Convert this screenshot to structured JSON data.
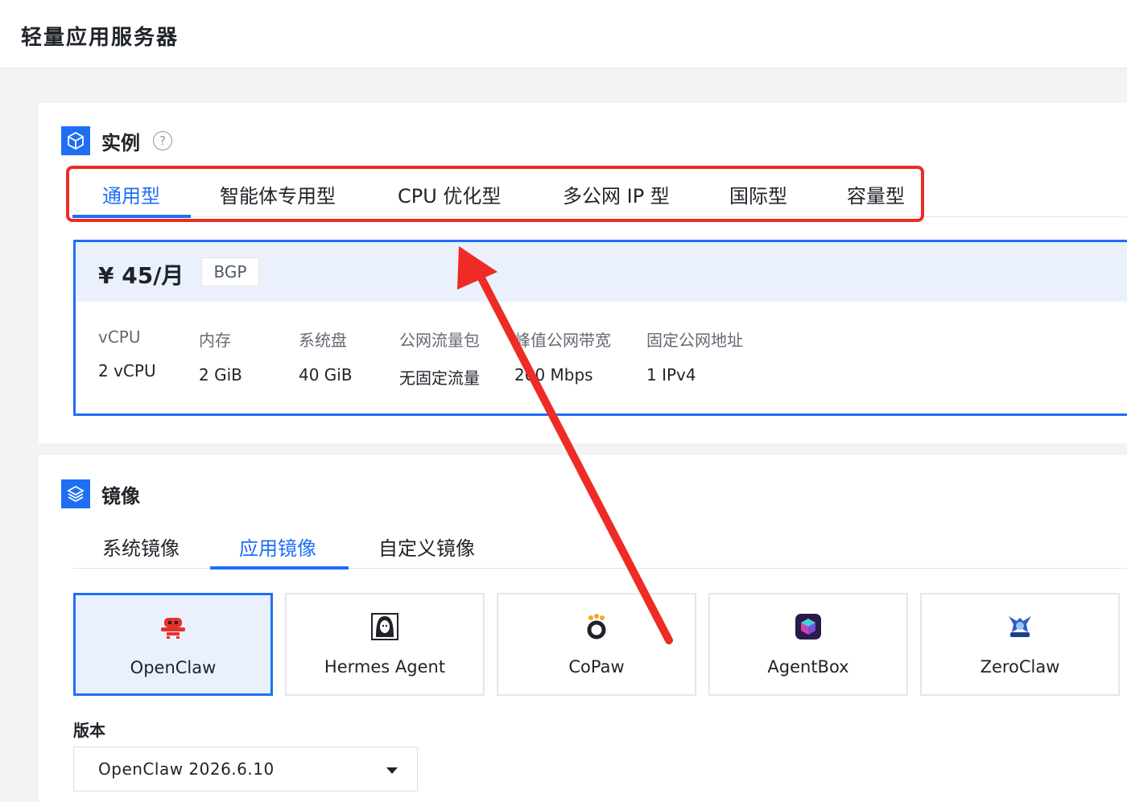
{
  "header": {
    "title": "轻量应用服务器"
  },
  "instance": {
    "title": "实例",
    "help_icon": "question-circle-icon",
    "tabs": [
      {
        "label": "通用型",
        "active": true
      },
      {
        "label": "智能体专用型",
        "active": false
      },
      {
        "label": "CPU 优化型",
        "active": false
      },
      {
        "label": "多公网 IP 型",
        "active": false
      },
      {
        "label": "国际型",
        "active": false
      },
      {
        "label": "容量型",
        "active": false
      }
    ],
    "plan": {
      "price": "¥ 45/月",
      "badge": "BGP",
      "specs": [
        {
          "label": "vCPU",
          "value": "2 vCPU"
        },
        {
          "label": "内存",
          "value": "2 GiB"
        },
        {
          "label": "系统盘",
          "value": "40 GiB"
        },
        {
          "label": "公网流量包",
          "value": "无固定流量"
        },
        {
          "label": "峰值公网带宽",
          "value": "200 Mbps"
        },
        {
          "label": "固定公网地址",
          "value": "1 IPv4"
        }
      ]
    }
  },
  "image": {
    "title": "镜像",
    "tabs": [
      {
        "label": "系统镜像",
        "active": false
      },
      {
        "label": "应用镜像",
        "active": true
      },
      {
        "label": "自定义镜像",
        "active": false
      }
    ],
    "apps": [
      {
        "name": "OpenClaw",
        "icon": "openclaw-icon",
        "selected": true
      },
      {
        "name": "Hermes Agent",
        "icon": "hermes-agent-icon",
        "selected": false
      },
      {
        "name": "CoPaw",
        "icon": "copaw-icon",
        "selected": false
      },
      {
        "name": "AgentBox",
        "icon": "agentbox-icon",
        "selected": false
      },
      {
        "name": "ZeroClaw",
        "icon": "zeroclaw-icon",
        "selected": false
      }
    ],
    "version_label": "版本",
    "version_value": "OpenClaw 2026.6.10"
  },
  "colors": {
    "accent": "#1f6ff5",
    "annotation": "#ee2b24",
    "selected_bg": "#eaf1fd"
  }
}
